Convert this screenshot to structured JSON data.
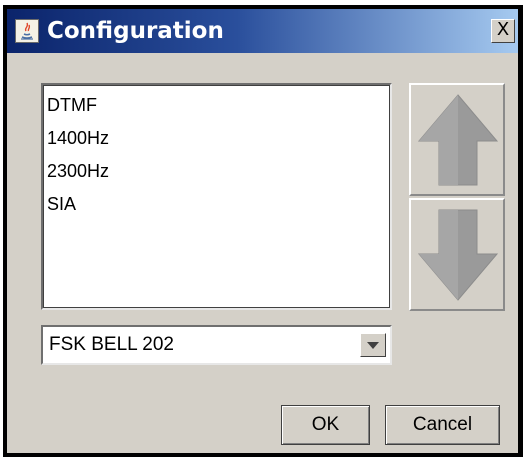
{
  "window": {
    "title": "Configuration",
    "close_label": "X"
  },
  "list": {
    "items": [
      "DTMF",
      "1400Hz",
      "2300Hz",
      "SIA"
    ]
  },
  "combo": {
    "selected": "FSK BELL 202"
  },
  "buttons": {
    "ok_label": "OK",
    "cancel_label": "Cancel"
  },
  "icons": {
    "move_up": "arrow-up-icon",
    "move_down": "arrow-down-icon",
    "combo_arrow": "chevron-down-icon",
    "app": "java-icon"
  },
  "colors": {
    "title_gradient_start": "#0b246b",
    "title_gradient_end": "#a6caf0",
    "dialog_bg": "#d4d0c8",
    "arrow_fill": "#9a9a9a"
  }
}
